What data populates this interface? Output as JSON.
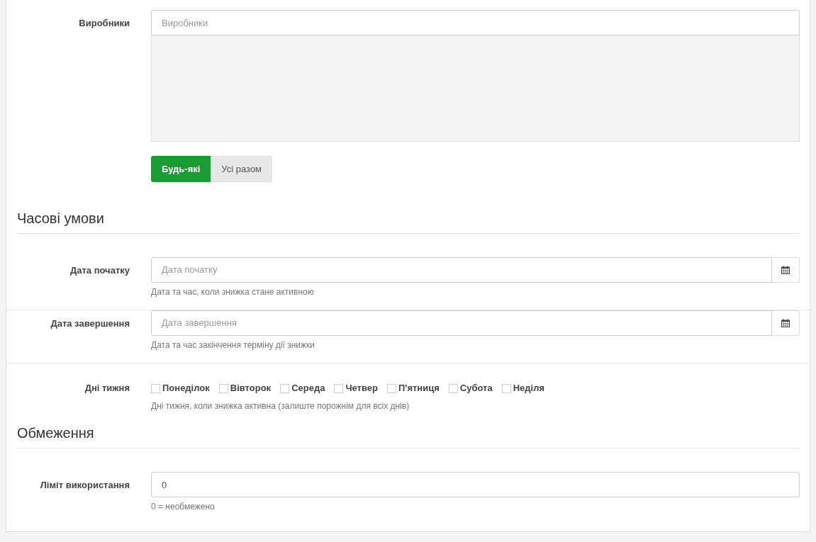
{
  "manufacturers": {
    "label": "Виробники",
    "placeholder": "Виробники",
    "mode_buttons": [
      {
        "label": "Будь-які",
        "selected": true
      },
      {
        "label": "Усі разом",
        "selected": false
      }
    ]
  },
  "time_section": {
    "heading": "Часові умови",
    "date_fields": [
      {
        "label": "Дата початку",
        "placeholder": "Дата початку",
        "help": "Дата та час, коли знижка стане активною"
      },
      {
        "label": "Дата завершення",
        "placeholder": "Дата завершення",
        "help": "Дата та час закінчення терміну дії знижки"
      }
    ],
    "weekdays": {
      "label": "Дні тижня",
      "help": "Дні тижня, коли знижка активна (залиште порожнім для всіх днів)",
      "days": [
        {
          "label": "Понеділок",
          "checked": false
        },
        {
          "label": "Вівторок",
          "checked": false
        },
        {
          "label": "Середа",
          "checked": false
        },
        {
          "label": "Четвер",
          "checked": false
        },
        {
          "label": "П'ятниця",
          "checked": false
        },
        {
          "label": "Субота",
          "checked": false
        },
        {
          "label": "Неділя",
          "checked": false
        }
      ]
    }
  },
  "limits_section": {
    "heading": "Обмеження",
    "usage_limit": {
      "label": "Ліміт використання",
      "value": "0",
      "help": "0 = необмежено"
    }
  }
}
